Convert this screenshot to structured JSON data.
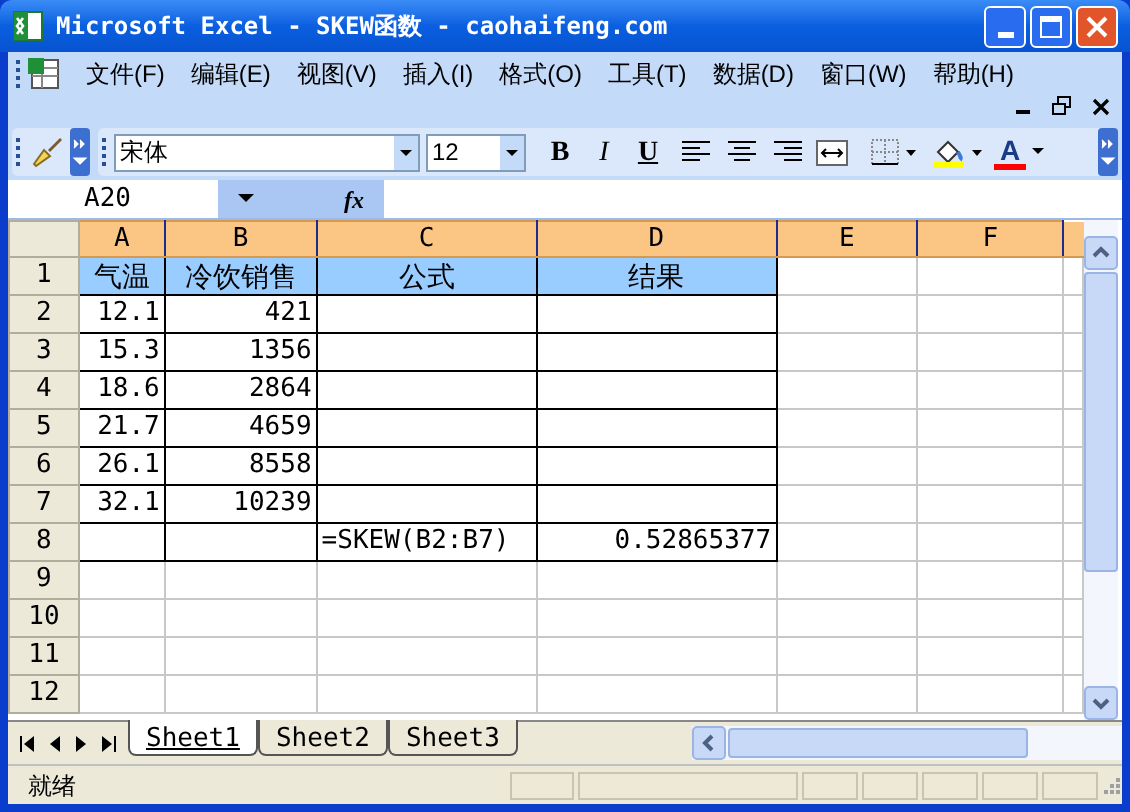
{
  "window": {
    "title": "Microsoft Excel - SKEW函数 - caohaifeng.com"
  },
  "menu": [
    "文件(F)",
    "编辑(E)",
    "视图(V)",
    "插入(I)",
    "格式(O)",
    "工具(T)",
    "数据(D)",
    "窗口(W)",
    "帮助(H)"
  ],
  "toolbar": {
    "font_name": "宋体",
    "font_size": "12",
    "format_buttons": [
      {
        "label": "B",
        "kind": "bold"
      },
      {
        "label": "I",
        "kind": "italic"
      },
      {
        "label": "U",
        "kind": "underline"
      }
    ],
    "font_color_label": "A"
  },
  "formula_bar": {
    "name_box": "A20",
    "fx_label": "fx"
  },
  "sheet": {
    "columns": [
      "A",
      "B",
      "C",
      "D",
      "E",
      "F"
    ],
    "rows": [
      {
        "number": "1",
        "kind": "header",
        "cells": [
          "气温",
          "冷饮销售",
          "公式",
          "结果"
        ]
      },
      {
        "number": "2",
        "kind": "data",
        "cells": [
          "12.1",
          "421",
          null,
          null
        ]
      },
      {
        "number": "3",
        "kind": "data",
        "cells": [
          "15.3",
          "1356",
          null,
          null
        ]
      },
      {
        "number": "4",
        "kind": "data",
        "cells": [
          "18.6",
          "2864",
          null,
          null
        ]
      },
      {
        "number": "5",
        "kind": "data",
        "cells": [
          "21.7",
          "4659",
          null,
          null
        ]
      },
      {
        "number": "6",
        "kind": "data",
        "cells": [
          "26.1",
          "8558",
          null,
          null
        ]
      },
      {
        "number": "7",
        "kind": "data",
        "cells": [
          "32.1",
          "10239",
          null,
          null
        ]
      },
      {
        "number": "8",
        "kind": "data",
        "cells": [
          null,
          null,
          "=SKEW(B2:B7)",
          "0.52865377"
        ]
      },
      {
        "number": "9",
        "kind": "empty",
        "cells": []
      },
      {
        "number": "10",
        "kind": "empty",
        "cells": []
      },
      {
        "number": "11",
        "kind": "empty",
        "cells": []
      },
      {
        "number": "12",
        "kind": "empty",
        "cells": []
      }
    ]
  },
  "sheet_tabs": [
    {
      "label": "Sheet1",
      "selected": true
    },
    {
      "label": "Sheet2",
      "selected": false
    },
    {
      "label": "Sheet3",
      "selected": false
    }
  ],
  "status_bar": {
    "text": "就绪"
  }
}
